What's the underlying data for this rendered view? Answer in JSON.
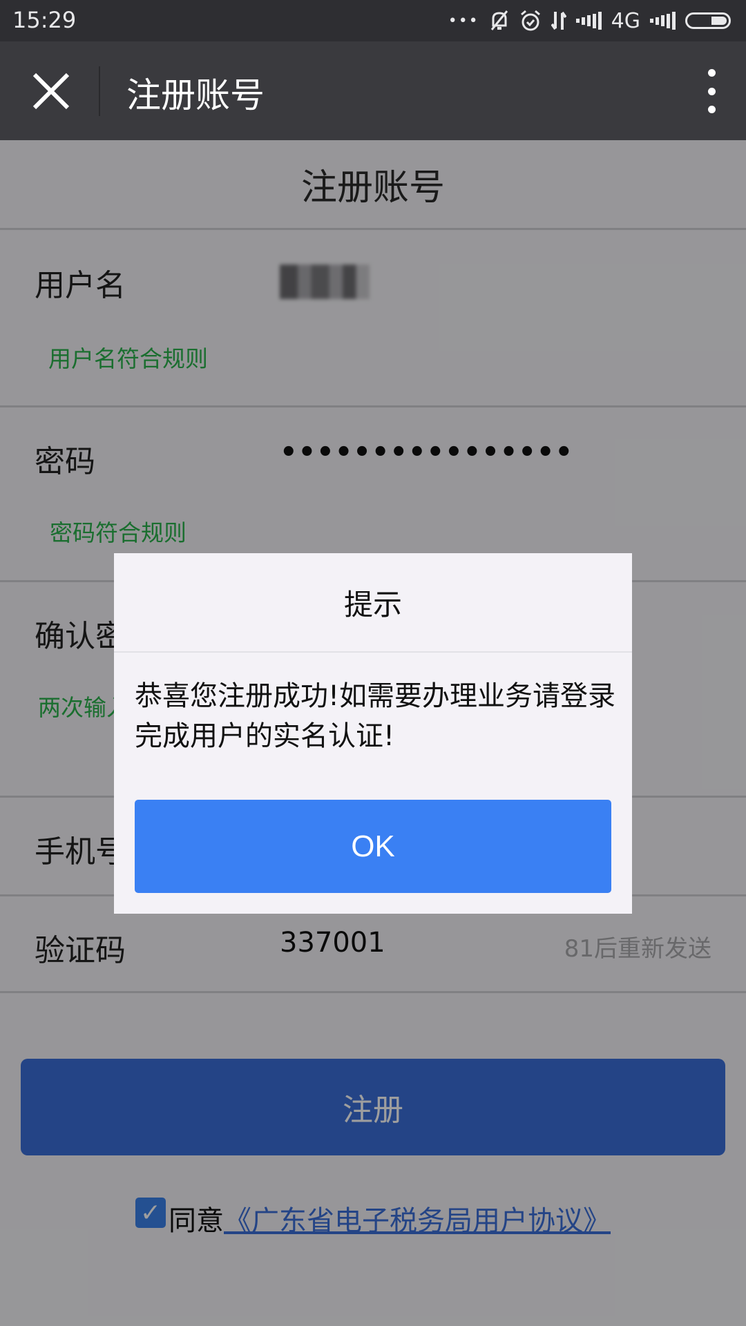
{
  "status_bar": {
    "time": "15:29",
    "icons": [
      "more-notifications-icon",
      "bell-muted-icon",
      "alarm-icon",
      "data-transfer-icon",
      "signal-icon",
      "signal-icon"
    ],
    "network": "4G",
    "more_dots": "•••"
  },
  "app_bar": {
    "title": "注册账号",
    "close_icon": "close-icon",
    "menu_icon": "more-vertical-icon"
  },
  "page": {
    "header": "注册账号",
    "fields": [
      {
        "label": "用户名",
        "value": "",
        "value_obscured": true,
        "hint": "用户名符合规则"
      },
      {
        "label": "密码",
        "value": "••••••••••••••••",
        "hint": "密码符合规则"
      },
      {
        "label": "确认密码",
        "value": "••••••••••••••••",
        "hint": "两次输入密码一致"
      },
      {
        "label": "手机号",
        "value": ""
      },
      {
        "label": "验证码",
        "value": "337001",
        "action": "81后重新发送"
      }
    ],
    "register_button": "注册",
    "agreement": {
      "checked": true,
      "check_glyph": "✓",
      "prefix": "同意",
      "link": "《广东省电子税务局用户协议》"
    }
  },
  "dialog": {
    "title": "提示",
    "message": "恭喜您注册成功!如需要办理业务请登录完成用户的实名认证!",
    "ok_label": "OK"
  },
  "colors": {
    "accent_blue": "#3a80f3",
    "register_blue": "#3b6fd8",
    "hint_green": "#2bb24c",
    "app_bar": "#3a3a3e",
    "status_bar": "#2e2e32"
  }
}
